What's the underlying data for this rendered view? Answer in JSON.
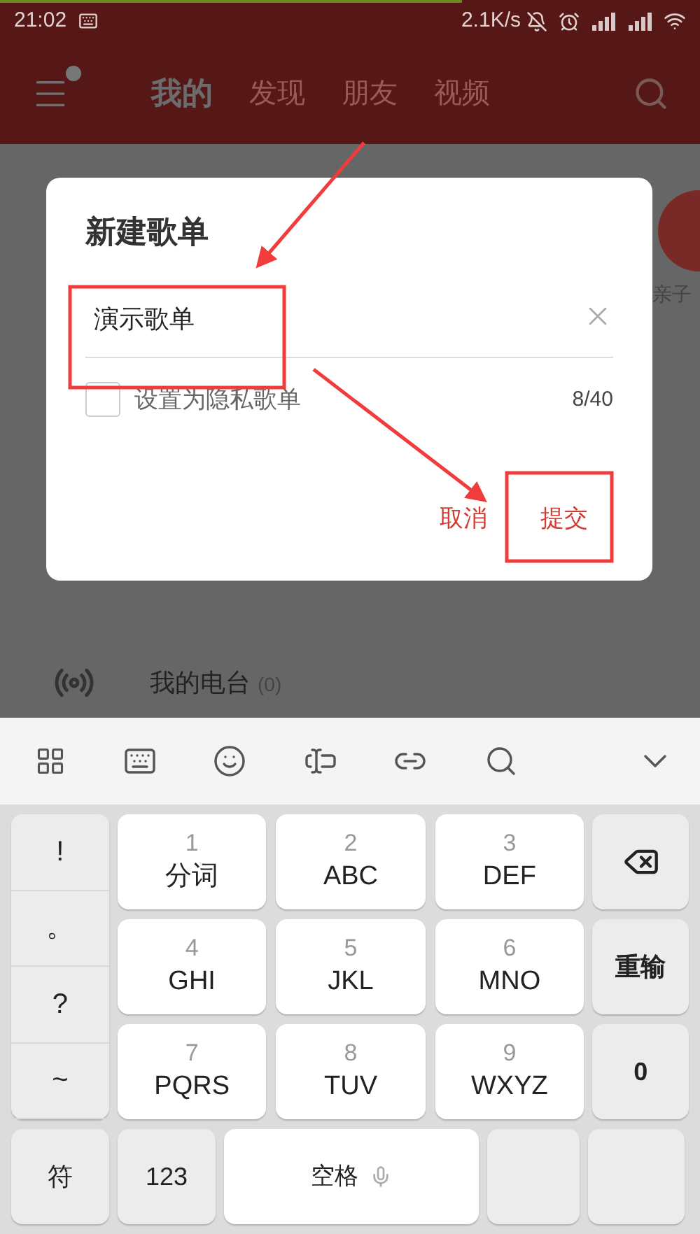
{
  "status_bar": {
    "time": "21:02",
    "speed": "2.1K/s"
  },
  "nav": {
    "tabs": [
      {
        "label": "我的",
        "selected": true
      },
      {
        "label": "发现",
        "selected": false
      },
      {
        "label": "朋友",
        "selected": false
      },
      {
        "label": "视频",
        "selected": false
      }
    ]
  },
  "background": {
    "shortcut_label": "亲子",
    "rows": [
      {
        "label": "我的电台",
        "count": "(0)"
      }
    ]
  },
  "dialog": {
    "title": "新建歌单",
    "input_value": "演示歌单",
    "private_checkbox": {
      "label": "设置为隐私歌单",
      "checked": false
    },
    "counter": "8/40",
    "buttons": [
      {
        "label": "取消"
      },
      {
        "label": "提交"
      }
    ]
  },
  "keyboard": {
    "symbols": [
      "!",
      "。",
      "?",
      "~"
    ],
    "keys": [
      {
        "digit": "1",
        "letters": "分词"
      },
      {
        "digit": "2",
        "letters": "ABC"
      },
      {
        "digit": "3",
        "letters": "DEF"
      },
      {
        "digit": "4",
        "letters": "GHI"
      },
      {
        "digit": "5",
        "letters": "JKL"
      },
      {
        "digit": "6",
        "letters": "MNO"
      },
      {
        "digit": "7",
        "letters": "PQRS"
      },
      {
        "digit": "8",
        "letters": "TUV"
      },
      {
        "digit": "9",
        "letters": "WXYZ"
      }
    ],
    "side_keys": [
      {
        "kind": "backspace"
      },
      {
        "kind": "text",
        "label": "重输"
      },
      {
        "kind": "text",
        "label": "0"
      }
    ],
    "bottom_keys": [
      {
        "kind": "text",
        "label": "符"
      },
      {
        "kind": "text",
        "label": "123"
      },
      {
        "kind": "space",
        "label": "空格"
      },
      {
        "kind": "blank"
      },
      {
        "kind": "blank"
      }
    ]
  }
}
